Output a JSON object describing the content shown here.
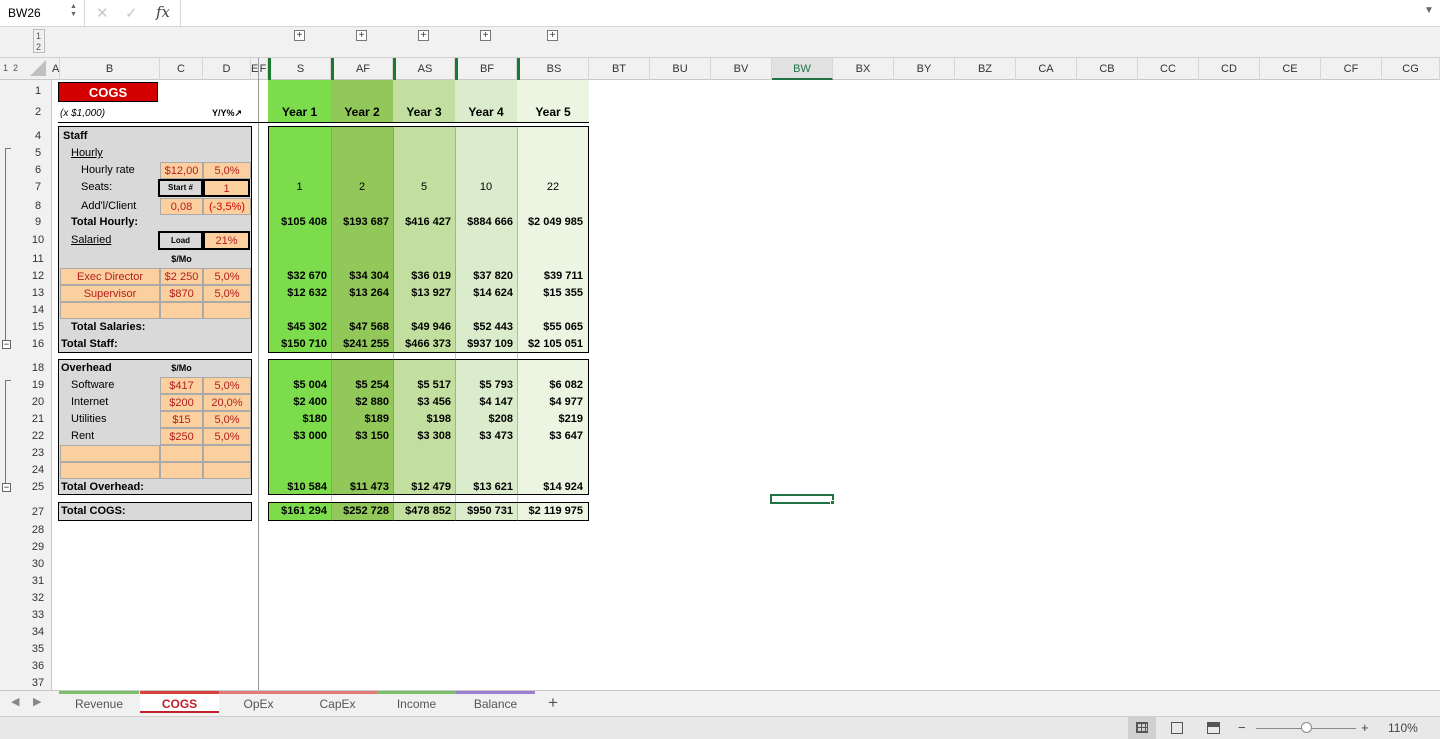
{
  "formula_bar": {
    "name_box": "BW26",
    "fx": "fx",
    "cancel": "✕",
    "confirm": "✓",
    "expand": "▼"
  },
  "outline": {
    "level_labels": [
      "1",
      "2"
    ],
    "row_levels": [
      "1",
      "2"
    ]
  },
  "columns": [
    {
      "id": "A",
      "label": "A"
    },
    {
      "id": "B",
      "label": "B"
    },
    {
      "id": "C",
      "label": "C"
    },
    {
      "id": "D",
      "label": "D"
    },
    {
      "id": "E",
      "label": "E"
    },
    {
      "id": "F",
      "label": "F"
    },
    {
      "id": "S",
      "label": "S"
    },
    {
      "id": "AF",
      "label": "AF"
    },
    {
      "id": "AS",
      "label": "AS"
    },
    {
      "id": "BF",
      "label": "BF"
    },
    {
      "id": "BS",
      "label": "BS"
    },
    {
      "id": "BT",
      "label": "BT"
    },
    {
      "id": "BU",
      "label": "BU"
    },
    {
      "id": "BV",
      "label": "BV"
    },
    {
      "id": "BW",
      "label": "BW"
    },
    {
      "id": "BX",
      "label": "BX"
    },
    {
      "id": "BY",
      "label": "BY"
    },
    {
      "id": "BZ",
      "label": "BZ"
    },
    {
      "id": "CA",
      "label": "CA"
    },
    {
      "id": "CB",
      "label": "CB"
    },
    {
      "id": "CC",
      "label": "CC"
    },
    {
      "id": "CD",
      "label": "CD"
    },
    {
      "id": "CE",
      "label": "CE"
    },
    {
      "id": "CF",
      "label": "CF"
    },
    {
      "id": "CG",
      "label": "CG"
    }
  ],
  "rows": [
    "1",
    "2",
    "4",
    "5",
    "6",
    "7",
    "8",
    "9",
    "10",
    "11",
    "12",
    "13",
    "14",
    "15",
    "16",
    "18",
    "19",
    "20",
    "21",
    "22",
    "23",
    "24",
    "25",
    "27",
    "28",
    "29",
    "30",
    "31",
    "32",
    "33",
    "34",
    "35",
    "36",
    "37"
  ],
  "sheet": {
    "title": "COGS",
    "units": "(x $1,000)",
    "yy_label": "Y/Y%↗",
    "years": [
      "Year 1",
      "Year 2",
      "Year 3",
      "Year 4",
      "Year 5"
    ],
    "staff": {
      "label": "Staff",
      "hourly": "Hourly",
      "hourly_rate": "Hourly rate",
      "hourly_rate_val": "$12,00",
      "hourly_rate_pct": "5,0%",
      "seats": "Seats:",
      "start_label": "Start #",
      "start_val": "1",
      "addl": "Add'l/Client",
      "addl_val": "0,08",
      "addl_pct": "(-3,5%)",
      "total_hourly": "Total Hourly:",
      "salaried": "Salaried",
      "load_label": "Load",
      "load_val": "21%",
      "per_mo": "$/Mo",
      "exec": "Exec Director",
      "exec_val": "$2 250",
      "exec_pct": "5,0%",
      "sup": "Supervisor",
      "sup_val": "$870",
      "sup_pct": "5,0%",
      "total_salaries": "Total Salaries:",
      "total_staff": "Total Staff:"
    },
    "overhead": {
      "label": "Overhead",
      "per_mo": "$/Mo",
      "items": [
        {
          "name": "Software",
          "val": "$417",
          "pct": "5,0%"
        },
        {
          "name": "Internet",
          "val": "$200",
          "pct": "20,0%"
        },
        {
          "name": "Utilities",
          "val": "$15",
          "pct": "5,0%"
        },
        {
          "name": "Rent",
          "val": "$250",
          "pct": "5,0%"
        }
      ],
      "total": "Total Overhead:"
    },
    "total_cogs": "Total COGS:",
    "yearly": {
      "seats": [
        "1",
        "2",
        "5",
        "10",
        "22"
      ],
      "total_hourly": [
        "$105 408",
        "$193 687",
        "$416 427",
        "$884 666",
        "$2 049 985"
      ],
      "exec": [
        "$32 670",
        "$34 304",
        "$36 019",
        "$37 820",
        "$39 711"
      ],
      "sup": [
        "$12 632",
        "$13 264",
        "$13 927",
        "$14 624",
        "$15 355"
      ],
      "total_salaries": [
        "$45 302",
        "$47 568",
        "$49 946",
        "$52 443",
        "$55 065"
      ],
      "total_staff": [
        "$150 710",
        "$241 255",
        "$466 373",
        "$937 109",
        "$2 105 051"
      ],
      "software": [
        "$5 004",
        "$5 254",
        "$5 517",
        "$5 793",
        "$6 082"
      ],
      "internet": [
        "$2 400",
        "$2 880",
        "$3 456",
        "$4 147",
        "$4 977"
      ],
      "utilities": [
        "$180",
        "$189",
        "$198",
        "$208",
        "$219"
      ],
      "rent": [
        "$3 000",
        "$3 150",
        "$3 308",
        "$3 473",
        "$3 647"
      ],
      "total_overhead": [
        "$10 584",
        "$11 473",
        "$12 479",
        "$13 621",
        "$14 924"
      ],
      "total_cogs": [
        "$161 294",
        "$252 728",
        "$478 852",
        "$950 731",
        "$2 119 975"
      ]
    }
  },
  "tabs": [
    {
      "label": "Revenue",
      "color": "#7bbf6a"
    },
    {
      "label": "COGS",
      "color": "#d94040"
    },
    {
      "label": "OpEx",
      "color": "#e07a7a"
    },
    {
      "label": "CapEx",
      "color": "#e07a7a"
    },
    {
      "label": "Income",
      "color": "#7bbf6a"
    },
    {
      "label": "Balance",
      "color": "#9a7fd0"
    }
  ],
  "add_tab": "+",
  "status": {
    "zoom": "110%",
    "minus": "−",
    "plus": "+"
  },
  "colors": {
    "title_red": "#d20000",
    "yr1": "#7cdc4c",
    "yr2": "#92c75a",
    "yr3": "#c3dfa0",
    "yr4": "#daeccb",
    "yr5": "#ebf5e1",
    "accent": "#217346"
  }
}
